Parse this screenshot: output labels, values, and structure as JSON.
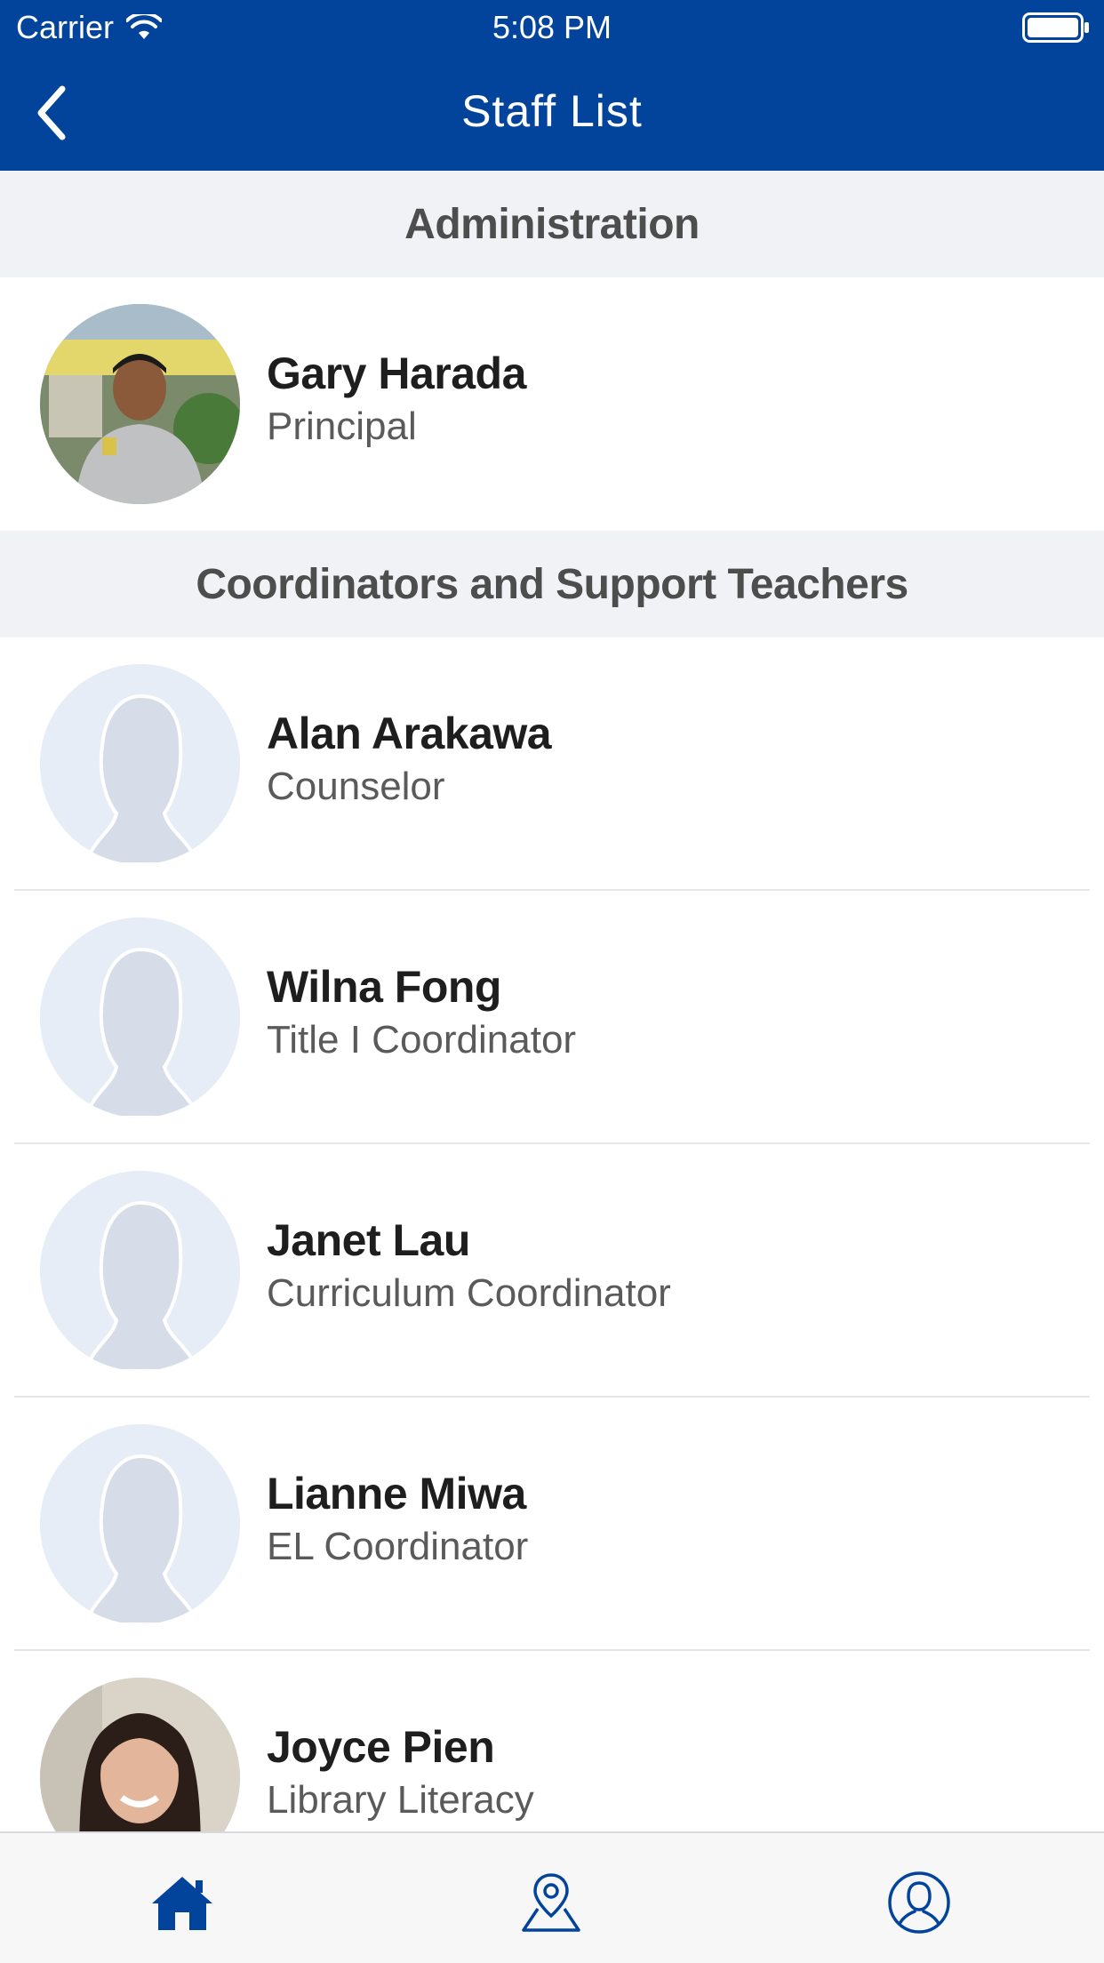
{
  "status_bar": {
    "carrier": "Carrier",
    "time": "5:08 PM"
  },
  "header": {
    "title": "Staff List",
    "back_icon": "chevron-left-icon"
  },
  "sections": [
    {
      "title": "Administration",
      "staff": [
        {
          "name": "Gary Harada",
          "role": "Principal",
          "avatar": "photo"
        }
      ]
    },
    {
      "title": "Coordinators and Support Teachers",
      "staff": [
        {
          "name": "Alan Arakawa",
          "role": "Counselor",
          "avatar": "placeholder"
        },
        {
          "name": "Wilna Fong",
          "role": "Title I Coordinator",
          "avatar": "placeholder"
        },
        {
          "name": "Janet Lau",
          "role": "Curriculum Coordinator",
          "avatar": "placeholder"
        },
        {
          "name": "Lianne Miwa",
          "role": "EL Coordinator",
          "avatar": "placeholder"
        },
        {
          "name": "Joyce Pien",
          "role": "Library Literacy",
          "avatar": "photo"
        }
      ]
    }
  ],
  "tabbar": {
    "tabs": [
      {
        "icon": "home-icon",
        "active": true
      },
      {
        "icon": "map-pin-icon",
        "active": false
      },
      {
        "icon": "profile-icon",
        "active": false
      }
    ]
  },
  "colors": {
    "primary": "#02449b",
    "section_bg": "#f1f2f6",
    "placeholder_bg": "#e7edf6",
    "placeholder_fg": "#d6dde8"
  }
}
